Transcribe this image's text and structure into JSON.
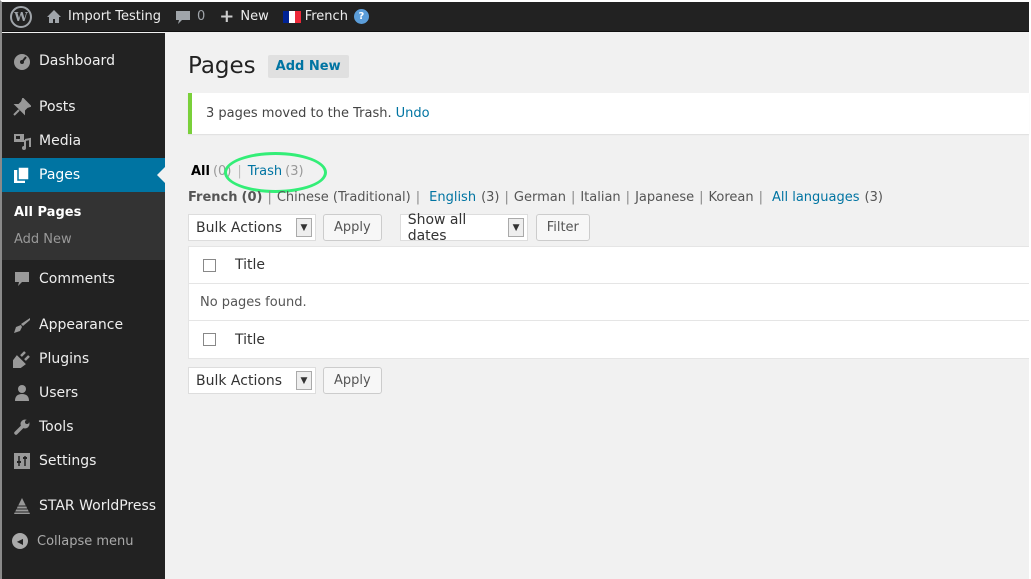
{
  "adminbar": {
    "site_name": "Import Testing",
    "comments_count": "0",
    "new_label": "New",
    "language": "French",
    "flag_colors": [
      "#002395",
      "#ffffff",
      "#ed2939"
    ]
  },
  "sidebar": {
    "items": [
      {
        "label": "Dashboard",
        "icon": "dashboard-icon"
      },
      {
        "label": "Posts",
        "icon": "pin-icon"
      },
      {
        "label": "Media",
        "icon": "media-icon"
      },
      {
        "label": "Pages",
        "icon": "pages-icon",
        "active": true
      },
      {
        "label": "Comments",
        "icon": "comment-icon"
      },
      {
        "label": "Appearance",
        "icon": "brush-icon"
      },
      {
        "label": "Plugins",
        "icon": "plugin-icon"
      },
      {
        "label": "Users",
        "icon": "user-icon"
      },
      {
        "label": "Tools",
        "icon": "wrench-icon"
      },
      {
        "label": "Settings",
        "icon": "settings-icon"
      },
      {
        "label": "STAR WorldPress",
        "icon": "pyramid-icon"
      }
    ],
    "submenu": [
      {
        "label": "All Pages",
        "current": true
      },
      {
        "label": "Add New"
      }
    ],
    "collapse_label": "Collapse menu",
    "active_color": "#0074a2"
  },
  "main": {
    "title": "Pages",
    "add_new_label": "Add New",
    "notice": {
      "text": "3 pages moved to the Trash.",
      "undo_label": "Undo",
      "accent": "#7ad03a"
    },
    "views": {
      "all_label": "All",
      "all_count": "(0)",
      "trash_label": "Trash",
      "trash_count": "(3)"
    },
    "languages": {
      "french_label": "French",
      "french_count": "(0)",
      "chinese_label": "Chinese (Traditional)",
      "english_label": "English",
      "english_count": "(3)",
      "german_label": "German",
      "italian_label": "Italian",
      "japanese_label": "Japanese",
      "korean_label": "Korean",
      "all_label": "All languages",
      "all_count": "(3)"
    },
    "top_nav": {
      "bulk_actions": "Bulk Actions",
      "apply": "Apply",
      "dates": "Show all dates",
      "filter": "Filter"
    },
    "table": {
      "column_title": "Title",
      "empty_message": "No pages found."
    },
    "bottom_nav": {
      "bulk_actions": "Bulk Actions",
      "apply": "Apply"
    }
  }
}
